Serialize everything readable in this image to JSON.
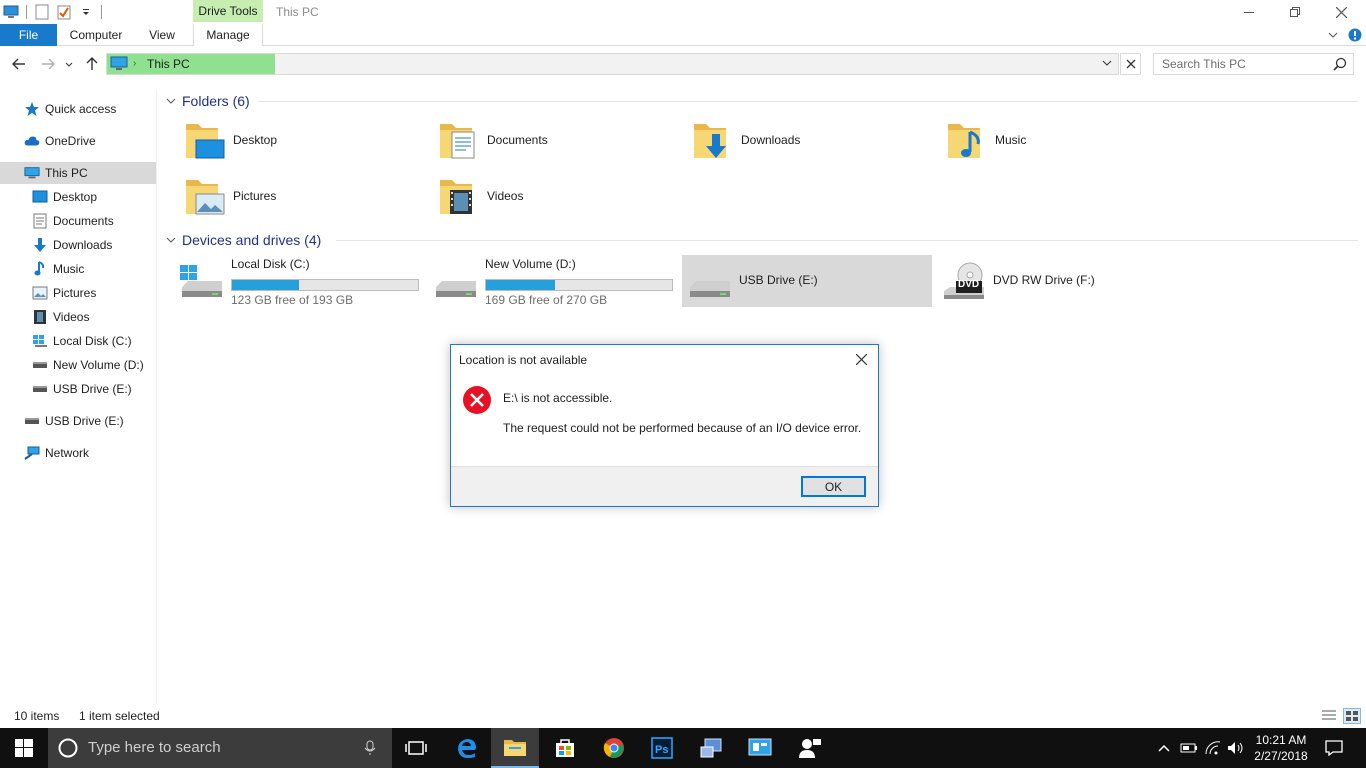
{
  "window": {
    "title": "This PC",
    "contextual_tab": "Drive Tools"
  },
  "ribbon": {
    "tabs": [
      "File",
      "Computer",
      "View",
      "Manage"
    ]
  },
  "address": {
    "path": "This PC",
    "search_placeholder": "Search This PC"
  },
  "nav": {
    "items": [
      "Quick access",
      "OneDrive",
      "This PC",
      "Desktop",
      "Documents",
      "Downloads",
      "Music",
      "Pictures",
      "Videos",
      "Local Disk (C:)",
      "New Volume (D:)",
      "USB Drive (E:)",
      "USB Drive (E:)",
      "Network"
    ]
  },
  "folders": {
    "header": "Folders (6)",
    "items": [
      "Desktop",
      "Documents",
      "Downloads",
      "Music",
      "Pictures",
      "Videos"
    ]
  },
  "devices": {
    "header": "Devices and drives (4)",
    "drives": [
      {
        "name": "Local Disk (C:)",
        "free": "123 GB free of 193 GB",
        "used_fraction": 0.36
      },
      {
        "name": "New Volume (D:)",
        "free": "169 GB free of 270 GB",
        "used_fraction": 0.37
      },
      {
        "name": "USB Drive (E:)"
      },
      {
        "name": "DVD RW Drive (F:)",
        "badge": "DVD"
      }
    ]
  },
  "status": {
    "count": "10 items",
    "selection": "1 item selected"
  },
  "dialog": {
    "title": "Location is not available",
    "message": "E:\\ is not accessible.",
    "detail": "The request could not be performed because of an I/O device error.",
    "ok_label": "OK"
  },
  "taskbar": {
    "search_placeholder": "Type here to search",
    "time": "10:21 AM",
    "date": "2/27/2018"
  },
  "colors": {
    "accent": "#1979ca",
    "drive_tools": "#c6eeb1",
    "progress": "#26a0da",
    "error": "#e81123"
  }
}
